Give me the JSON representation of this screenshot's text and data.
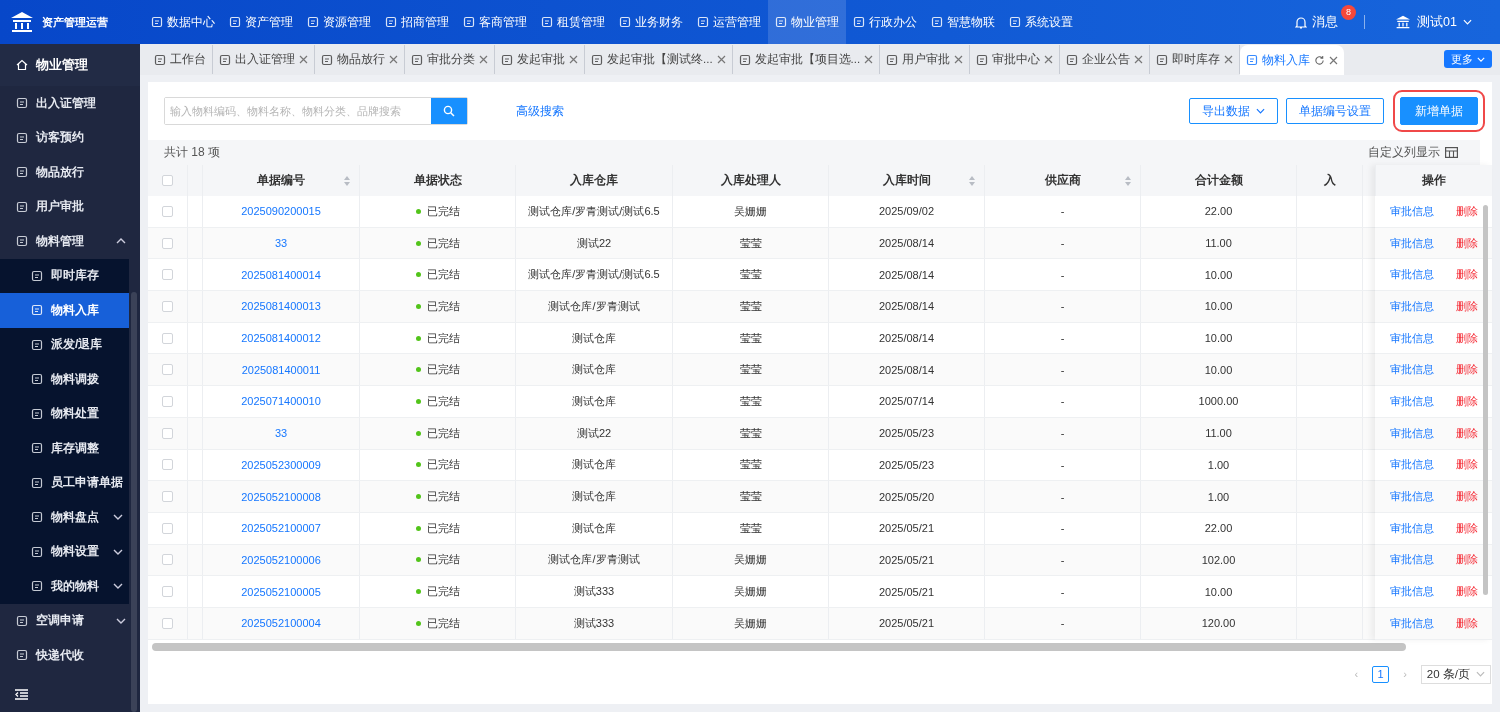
{
  "app_title": "资产管理运营",
  "top_nav": [
    {
      "label": "数据中心",
      "selected": false
    },
    {
      "label": "资产管理",
      "selected": false
    },
    {
      "label": "资源管理",
      "selected": false
    },
    {
      "label": "招商管理",
      "selected": false
    },
    {
      "label": "客商管理",
      "selected": false
    },
    {
      "label": "租赁管理",
      "selected": false
    },
    {
      "label": "业务财务",
      "selected": false
    },
    {
      "label": "运营管理",
      "selected": false
    },
    {
      "label": "物业管理",
      "selected": true
    },
    {
      "label": "行政办公",
      "selected": false
    },
    {
      "label": "智慧物联",
      "selected": false
    },
    {
      "label": "系统设置",
      "selected": false
    }
  ],
  "messages": {
    "label": "消息",
    "badge": "8"
  },
  "user": {
    "name": "测试01"
  },
  "sidebar": {
    "title": "物业管理",
    "items": [
      {
        "label": "出入证管理",
        "selected": false
      },
      {
        "label": "访客预约",
        "selected": false
      },
      {
        "label": "物品放行",
        "selected": false
      },
      {
        "label": "用户审批",
        "selected": false
      },
      {
        "label": "物料管理",
        "selected": false,
        "expanded": true,
        "children": [
          {
            "label": "即时库存",
            "selected": false
          },
          {
            "label": "物料入库",
            "selected": true
          },
          {
            "label": "派发/退库",
            "selected": false
          },
          {
            "label": "物料调拨",
            "selected": false
          },
          {
            "label": "物料处置",
            "selected": false
          },
          {
            "label": "库存调整",
            "selected": false
          },
          {
            "label": "员工申请单据",
            "selected": false
          },
          {
            "label": "物料盘点",
            "selected": false,
            "expanded": false
          },
          {
            "label": "物料设置",
            "selected": false,
            "expanded": false
          },
          {
            "label": "我的物料",
            "selected": false,
            "expanded": false
          }
        ]
      },
      {
        "label": "空调申请",
        "selected": false,
        "expanded": false
      },
      {
        "label": "快递代收",
        "selected": false
      }
    ]
  },
  "tabs": [
    {
      "label": "工作台",
      "selected": false,
      "closable": false
    },
    {
      "label": "出入证管理",
      "selected": false,
      "closable": true
    },
    {
      "label": "物品放行",
      "selected": false,
      "closable": true
    },
    {
      "label": "审批分类",
      "selected": false,
      "closable": true
    },
    {
      "label": "发起审批",
      "selected": false,
      "closable": true
    },
    {
      "label": "发起审批【测试终...",
      "selected": false,
      "closable": true
    },
    {
      "label": "发起审批【项目选...",
      "selected": false,
      "closable": true
    },
    {
      "label": "用户审批",
      "selected": false,
      "closable": true
    },
    {
      "label": "审批中心",
      "selected": false,
      "closable": true
    },
    {
      "label": "企业公告",
      "selected": false,
      "closable": true
    },
    {
      "label": "即时库存",
      "selected": false,
      "closable": true
    },
    {
      "label": "物料入库",
      "selected": true,
      "closable": true
    }
  ],
  "more_button": "更多",
  "search": {
    "placeholder": "输入物料编码、物料名称、物料分类、品牌搜索"
  },
  "advanced_search": "高级搜索",
  "buttons": [
    {
      "label": "导出数据",
      "kind": "dropdown"
    },
    {
      "label": "单据编号设置",
      "kind": "outline"
    },
    {
      "label": "新增单据",
      "kind": "primary"
    }
  ],
  "total": "共计 18 项",
  "custom_columns": "自定义列显示",
  "table": {
    "select_all": {
      "checked": false
    },
    "columns": [
      {
        "label": "单据编号",
        "sortable": true
      },
      {
        "label": "单据状态",
        "sortable": false
      },
      {
        "label": "入库仓库",
        "sortable": false
      },
      {
        "label": "入库处理人",
        "sortable": false
      },
      {
        "label": "入库时间",
        "sortable": true
      },
      {
        "label": "供应商",
        "sortable": true
      },
      {
        "label": "合计金额",
        "sortable": false
      },
      {
        "label": "入",
        "sortable": false
      },
      {
        "label": "操作",
        "sortable": false
      }
    ],
    "rows": [
      {
        "checked": false,
        "code": "2025090200015",
        "status": "已完结",
        "warehouse": "测试仓库/罗青测试/测试6.5",
        "handler": "吴姗姗",
        "date": "2025/09/02",
        "supplier": "-",
        "amount": "22.00",
        "actions": [
          "审批信息",
          "删除"
        ]
      },
      {
        "checked": false,
        "code": "33",
        "status": "已完结",
        "warehouse": "测试22",
        "handler": "莹莹",
        "date": "2025/08/14",
        "supplier": "-",
        "amount": "11.00",
        "actions": [
          "审批信息",
          "删除"
        ]
      },
      {
        "checked": false,
        "code": "2025081400014",
        "status": "已完结",
        "warehouse": "测试仓库/罗青测试/测试6.5",
        "handler": "莹莹",
        "date": "2025/08/14",
        "supplier": "-",
        "amount": "10.00",
        "actions": [
          "审批信息",
          "删除"
        ]
      },
      {
        "checked": false,
        "code": "2025081400013",
        "status": "已完结",
        "warehouse": "测试仓库/罗青测试",
        "handler": "莹莹",
        "date": "2025/08/14",
        "supplier": "-",
        "amount": "10.00",
        "actions": [
          "审批信息",
          "删除"
        ]
      },
      {
        "checked": false,
        "code": "2025081400012",
        "status": "已完结",
        "warehouse": "测试仓库",
        "handler": "莹莹",
        "date": "2025/08/14",
        "supplier": "-",
        "amount": "10.00",
        "actions": [
          "审批信息",
          "删除"
        ]
      },
      {
        "checked": false,
        "code": "2025081400011",
        "status": "已完结",
        "warehouse": "测试仓库",
        "handler": "莹莹",
        "date": "2025/08/14",
        "supplier": "-",
        "amount": "10.00",
        "actions": [
          "审批信息",
          "删除"
        ]
      },
      {
        "checked": false,
        "code": "2025071400010",
        "status": "已完结",
        "warehouse": "测试仓库",
        "handler": "莹莹",
        "date": "2025/07/14",
        "supplier": "-",
        "amount": "1000.00",
        "actions": [
          "审批信息",
          "删除"
        ]
      },
      {
        "checked": false,
        "code": "33",
        "status": "已完结",
        "warehouse": "测试22",
        "handler": "莹莹",
        "date": "2025/05/23",
        "supplier": "-",
        "amount": "11.00",
        "actions": [
          "审批信息",
          "删除"
        ]
      },
      {
        "checked": false,
        "code": "2025052300009",
        "status": "已完结",
        "warehouse": "测试仓库",
        "handler": "莹莹",
        "date": "2025/05/23",
        "supplier": "-",
        "amount": "1.00",
        "actions": [
          "审批信息",
          "删除"
        ]
      },
      {
        "checked": false,
        "code": "2025052100008",
        "status": "已完结",
        "warehouse": "测试仓库",
        "handler": "莹莹",
        "date": "2025/05/20",
        "supplier": "-",
        "amount": "1.00",
        "actions": [
          "审批信息",
          "删除"
        ]
      },
      {
        "checked": false,
        "code": "2025052100007",
        "status": "已完结",
        "warehouse": "测试仓库",
        "handler": "莹莹",
        "date": "2025/05/21",
        "supplier": "-",
        "amount": "22.00",
        "actions": [
          "审批信息",
          "删除"
        ]
      },
      {
        "checked": false,
        "code": "2025052100006",
        "status": "已完结",
        "warehouse": "测试仓库/罗青测试",
        "handler": "吴姗姗",
        "date": "2025/05/21",
        "supplier": "-",
        "amount": "102.00",
        "actions": [
          "审批信息",
          "删除"
        ]
      },
      {
        "checked": false,
        "code": "2025052100005",
        "status": "已完结",
        "warehouse": "测试333",
        "handler": "吴姗姗",
        "date": "2025/05/21",
        "supplier": "-",
        "amount": "10.00",
        "actions": [
          "审批信息",
          "删除"
        ]
      },
      {
        "checked": false,
        "code": "2025052100004",
        "status": "已完结",
        "warehouse": "测试333",
        "handler": "吴姗姗",
        "date": "2025/05/21",
        "supplier": "-",
        "amount": "120.00",
        "actions": [
          "审批信息",
          "删除"
        ]
      }
    ]
  },
  "pagination": {
    "prev": "‹",
    "next": "›",
    "pages": [
      {
        "label": "1",
        "selected": true
      }
    ],
    "page_size": "20 条/页"
  }
}
